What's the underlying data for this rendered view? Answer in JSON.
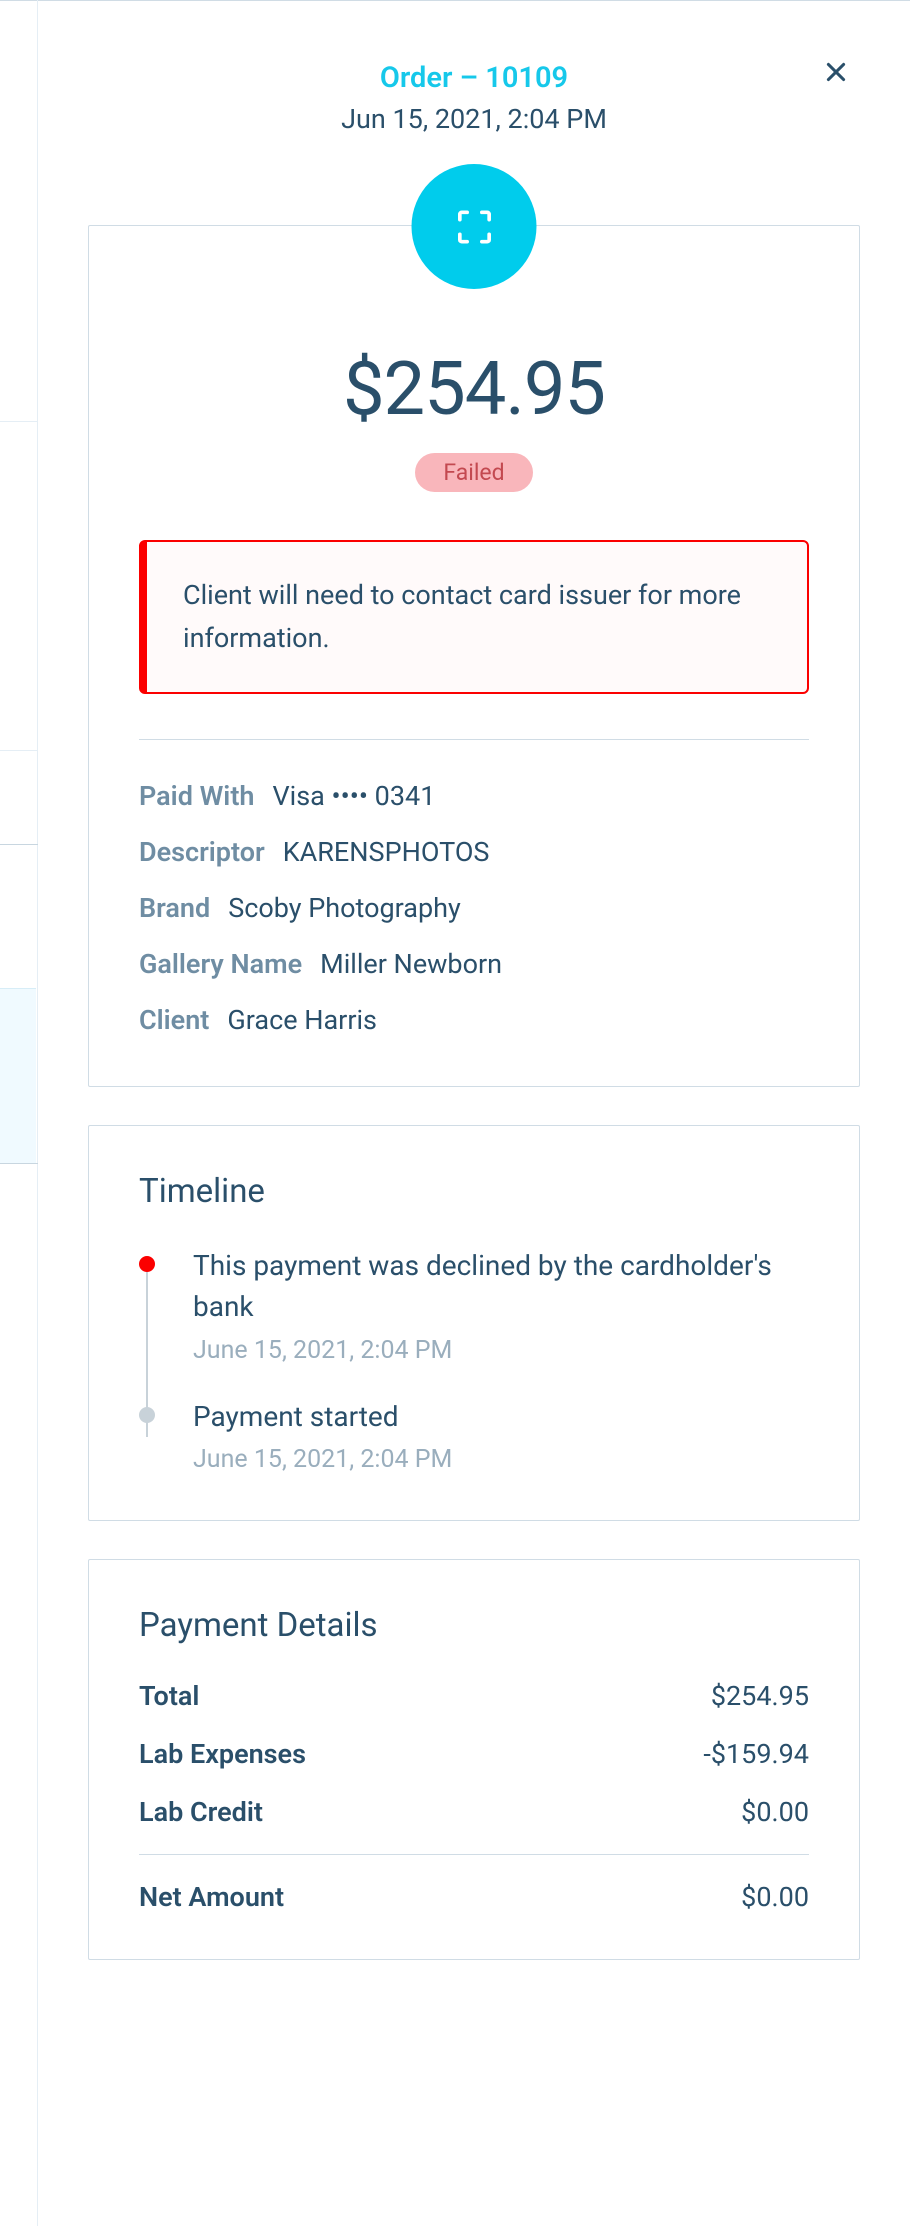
{
  "header": {
    "title": "Order – 10109",
    "date": "Jun 15, 2021, 2:04 PM"
  },
  "summary": {
    "amount": "$254.95",
    "status": "Failed",
    "alert": "Client will need to contact card issuer for more information.",
    "details": {
      "paid_with_label": "Paid With",
      "paid_with_value": "Visa •••• 0341",
      "descriptor_label": "Descriptor",
      "descriptor_value": "KARENSPHOTOS",
      "brand_label": "Brand",
      "brand_value": "Scoby Photography",
      "gallery_label": "Gallery Name",
      "gallery_value": "Miller Newborn",
      "client_label": "Client",
      "client_value": "Grace Harris"
    }
  },
  "timeline": {
    "title": "Timeline",
    "items": [
      {
        "title": "This payment was declined by the cardholder's bank",
        "time": "June 15, 2021, 2:04 PM",
        "dot": "red"
      },
      {
        "title": "Payment started",
        "time": "June 15, 2021, 2:04 PM",
        "dot": "gray"
      }
    ]
  },
  "payment_details": {
    "title": "Payment Details",
    "rows": [
      {
        "label": "Total",
        "value": "$254.95"
      },
      {
        "label": "Lab Expenses",
        "value": "-$159.94"
      },
      {
        "label": "Lab Credit",
        "value": "$0.00"
      }
    ],
    "net_label": "Net Amount",
    "net_value": "$0.00"
  }
}
